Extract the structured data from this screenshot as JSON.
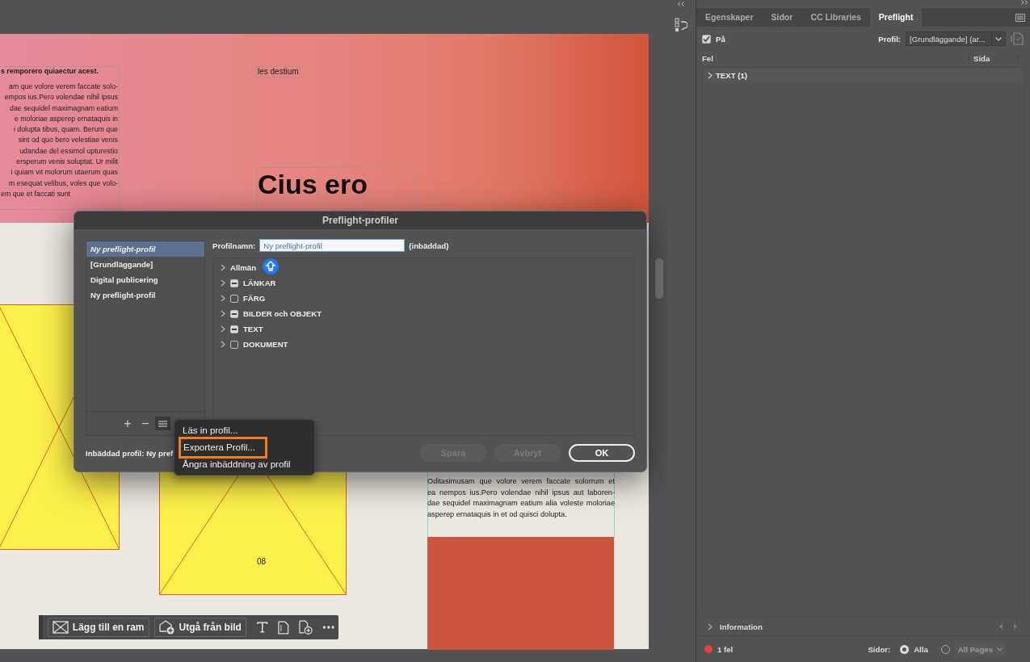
{
  "canvas": {
    "text_column": {
      "heading": "s remporero quiaectur acest.",
      "lines": [
        "am que volore verem faccate solo-",
        "empos ius.Pero volendae nihil ipsus",
        "dae sequidel maximagnam eatium",
        "e moloriae asperep ernataquis in",
        "i dolupta tibus, quam. Berum que",
        "sint od quo bero velestiae venis",
        "udandae del essimol upturestio",
        "ersperum venis soluptat. Ur milit",
        "i quiam vit molorum utaerum quas",
        "m esequat velibus, voles que volo-",
        "em que et faccati sunt"
      ]
    },
    "caption": "les destium",
    "headline": "Cius ero",
    "page_number": "08",
    "lower_paragraph": [
      "Oditasimusam que volore verem faccate solorrum et",
      "ea nempos ius.Pero volendae nihil ipsus aut laboren-",
      "dae sequidel maximagnam eatium alia voleste moloriae",
      "asperep ernataquis in et od quisci dolupta."
    ]
  },
  "frame_toolbar": {
    "buttons": [
      "Lägg till en ram",
      "Utgå från bild"
    ]
  },
  "dialog": {
    "title": "Preflight-profiler",
    "profiles": [
      {
        "label": "Ny preflight-profil",
        "selected": true
      },
      {
        "label": "[Grundläggande]",
        "selected": false
      },
      {
        "label": "Digital publicering",
        "selected": false
      },
      {
        "label": "Ny preflight-profil",
        "selected": false
      }
    ],
    "list_buttons": [
      "+",
      "−"
    ],
    "name_label": "Profilnamn:",
    "name_value": "Ny preflight-profil",
    "embedded_note": "(inbäddad)",
    "categories": [
      {
        "label": "Allmän",
        "kind": "plain"
      },
      {
        "label": "LÄNKAR",
        "kind": "checkbox",
        "mixed": true
      },
      {
        "label": "FÄRG",
        "kind": "checkbox",
        "mixed": false
      },
      {
        "label": "BILDER och OBJEKT",
        "kind": "checkbox",
        "mixed": true
      },
      {
        "label": "TEXT",
        "kind": "checkbox",
        "mixed": true
      },
      {
        "label": "DOKUMENT",
        "kind": "checkbox",
        "mixed": false
      }
    ],
    "embedded_profile": "Inbäddad profil: Ny pref",
    "buttons": [
      {
        "label": "Spara",
        "disabled": true
      },
      {
        "label": "Avbryt",
        "disabled": true
      },
      {
        "label": "OK",
        "disabled": false
      }
    ]
  },
  "context_menu": {
    "items": [
      {
        "label": "Läs in profil...",
        "highlighted": false
      },
      {
        "label": "Exportera Profil...",
        "highlighted": true
      },
      {
        "label": "Ångra inbäddning av profil",
        "highlighted": false
      }
    ]
  },
  "panel": {
    "tabs": [
      {
        "label": "Egenskaper",
        "selected": false
      },
      {
        "label": "Sidor",
        "selected": false
      },
      {
        "label": "CC Libraries",
        "selected": false
      },
      {
        "label": "Preflight",
        "selected": true
      }
    ],
    "on": {
      "label": "På",
      "checked": true
    },
    "profile_label": "Profil:",
    "profile_value": "[Grundläggande] (ar...",
    "columns": [
      "Fel",
      "Sida"
    ],
    "errors": [
      {
        "label": "TEXT (1)",
        "expanded": false
      }
    ],
    "info_label": "Information",
    "status": {
      "count": "1 fel",
      "color": "#e5403a"
    },
    "pages_label": "Sidor:",
    "page_options": [
      {
        "label": "Alla",
        "selected": true
      },
      {
        "label": "All Pages",
        "selected": false
      }
    ]
  }
}
